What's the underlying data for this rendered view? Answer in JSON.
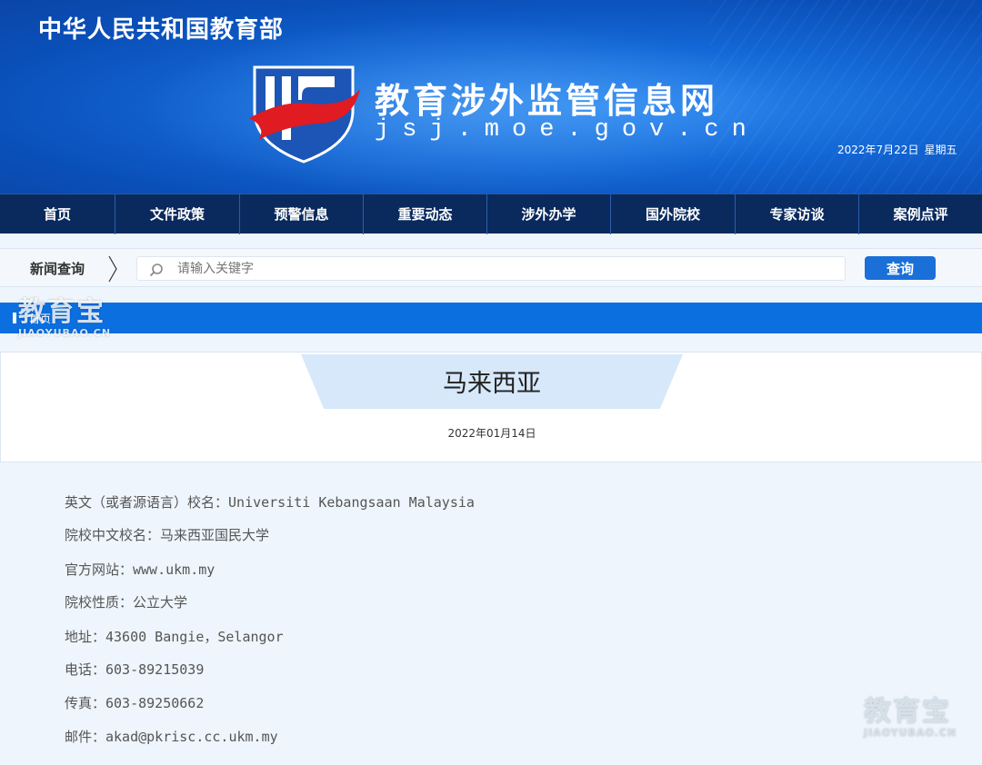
{
  "header": {
    "ministry": "中华人民共和国教育部",
    "site_title": "教育涉外监管信息网",
    "site_domain": "jsj.moe.gov.cn",
    "date": "2022年7月22日",
    "weekday": "星期五"
  },
  "nav": {
    "items": [
      {
        "label": "首页"
      },
      {
        "label": "文件政策"
      },
      {
        "label": "预警信息"
      },
      {
        "label": "重要动态"
      },
      {
        "label": "涉外办学"
      },
      {
        "label": "国外院校"
      },
      {
        "label": "专家访谈"
      },
      {
        "label": "案例点评"
      }
    ]
  },
  "search": {
    "label": "新闻查询",
    "placeholder": "请输入关键字",
    "button": "查询"
  },
  "breadcrumb": {
    "text": "首页"
  },
  "watermark": {
    "big": "教育宝",
    "small": "JIAOYUBAO.CN"
  },
  "article": {
    "title": "马来西亚",
    "date": "2022年01月14日",
    "lines": [
      "英文（或者源语言）校名：Universiti Kebangsaan Malaysia",
      "院校中文校名：马来西亚国民大学",
      "官方网站：www.ukm.my",
      "院校性质：公立大学",
      "地址：43600 Bangie，Selangor",
      "电话：603-89215039",
      "传真：603-89250662",
      "邮件：akad@pkrisc.cc.ukm.my"
    ]
  },
  "colors": {
    "nav_bg": "#0a2a5e",
    "accent": "#1a70d8",
    "breadcrumb_bg": "#0b6fe0",
    "title_tab": "#d7e8fb"
  }
}
